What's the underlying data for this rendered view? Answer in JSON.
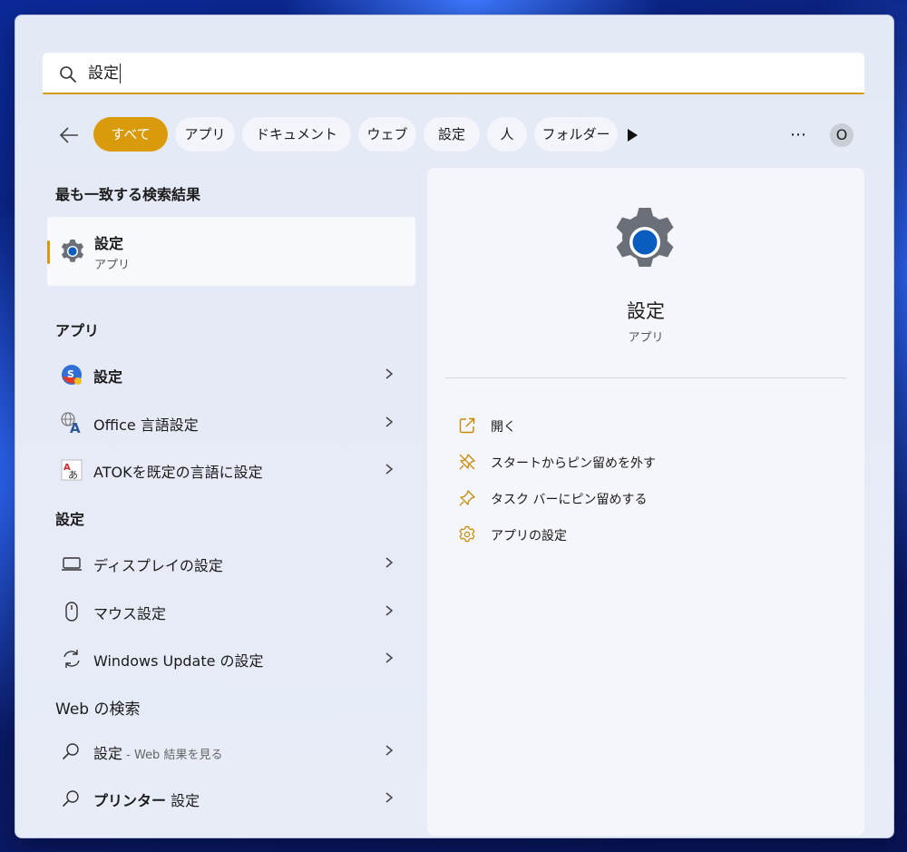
{
  "search": {
    "query": "設定"
  },
  "filters": [
    {
      "label": "すべて",
      "active": true
    },
    {
      "label": "アプリ"
    },
    {
      "label": "ドキュメント"
    },
    {
      "label": "ウェブ"
    },
    {
      "label": "設定"
    },
    {
      "label": "人"
    },
    {
      "label": "フォルダー"
    }
  ],
  "avatar": {
    "initial": "O"
  },
  "best_match": {
    "section_title": "最も一致する検索結果",
    "title": "設定",
    "subtitle": "アプリ"
  },
  "apps": {
    "section_title": "アプリ",
    "items": [
      {
        "label": "設定",
        "icon": "scansnap-settings-icon"
      },
      {
        "label": "Office 言語設定",
        "icon": "office-language-icon"
      },
      {
        "label": "ATOKを既定の言語に設定",
        "icon": "atok-icon"
      }
    ]
  },
  "settings": {
    "section_title": "設定",
    "items": [
      {
        "label": "ディスプレイの設定",
        "icon": "display-icon"
      },
      {
        "label": "マウス設定",
        "icon": "mouse-icon"
      },
      {
        "label": "Windows Update の設定",
        "icon": "sync-icon"
      }
    ]
  },
  "web": {
    "section_title": "Web の検索",
    "items": [
      {
        "label_main": "設定",
        "label_suffix": " - Web 結果を見る",
        "icon": "search-icon"
      },
      {
        "label_bold": "プリンター",
        "label_rest": " 設定",
        "icon": "search-icon"
      }
    ]
  },
  "detail": {
    "title": "設定",
    "subtitle": "アプリ",
    "actions": [
      {
        "label": "開く",
        "icon": "open-external-icon"
      },
      {
        "label": "スタートからピン留めを外す",
        "icon": "unpin-icon"
      },
      {
        "label": "タスク バーにピン留めする",
        "icon": "pin-icon"
      },
      {
        "label": "アプリの設定",
        "icon": "gear-icon"
      }
    ]
  },
  "colors": {
    "accent": "#d99a0b",
    "panel": "#e6ebf7"
  }
}
